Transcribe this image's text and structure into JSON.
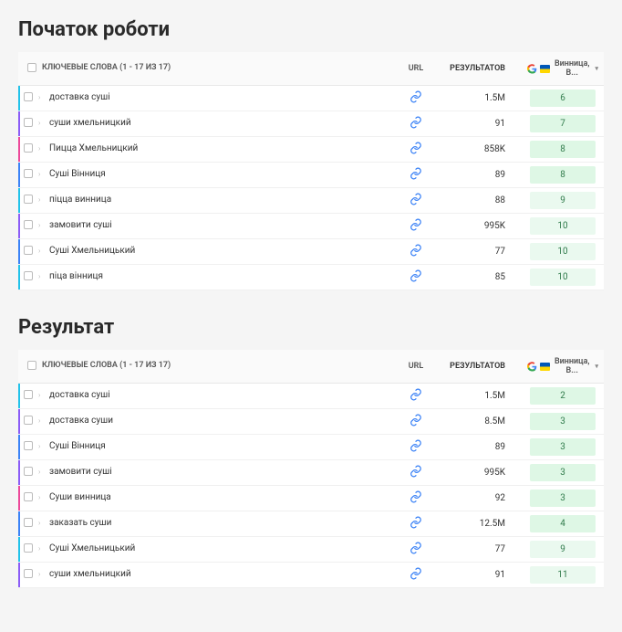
{
  "sections": [
    {
      "title": "Початок роботи",
      "headers": {
        "keywords": "КЛЮЧЕВЫЕ СЛОВА (1 - 17 ИЗ 17)",
        "url": "URL",
        "results": "РЕЗУЛЬТАТОВ",
        "region": "Винница, В..."
      },
      "rows": [
        {
          "kw": "доставка суші",
          "results": "1.5M",
          "rank": "6",
          "color": "#22c2e9"
        },
        {
          "kw": "суши хмельницкий",
          "results": "91",
          "rank": "7",
          "color": "#8b5cf6"
        },
        {
          "kw": "Пицца Хмельницкий",
          "results": "858K",
          "rank": "8",
          "color": "#ec4899"
        },
        {
          "kw": "Суші Вінниця",
          "results": "89",
          "rank": "8",
          "color": "#3b82f6"
        },
        {
          "kw": "піцца винница",
          "results": "88",
          "rank": "9",
          "color": "#22c2e9"
        },
        {
          "kw": "замовити суші",
          "results": "995K",
          "rank": "10",
          "color": "#8b5cf6"
        },
        {
          "kw": "Суші Хмельницький",
          "results": "77",
          "rank": "10",
          "color": "#3b82f6"
        },
        {
          "kw": "піца вінниця",
          "results": "85",
          "rank": "10",
          "color": "#22c2e9"
        }
      ]
    },
    {
      "title": "Результат",
      "headers": {
        "keywords": "КЛЮЧЕВЫЕ СЛОВА (1 - 17 ИЗ 17)",
        "url": "URL",
        "results": "РЕЗУЛЬТАТОВ",
        "region": "Винница, В..."
      },
      "rows": [
        {
          "kw": "доставка суші",
          "results": "1.5M",
          "rank": "2",
          "color": "#22c2e9"
        },
        {
          "kw": "доставка суши",
          "results": "8.5M",
          "rank": "3",
          "color": "#8b5cf6"
        },
        {
          "kw": "Суші Вінниця",
          "results": "89",
          "rank": "3",
          "color": "#3b82f6"
        },
        {
          "kw": "замовити суші",
          "results": "995K",
          "rank": "3",
          "color": "#8b5cf6"
        },
        {
          "kw": "Суши винница",
          "results": "92",
          "rank": "3",
          "color": "#ec4899"
        },
        {
          "kw": "заказать суши",
          "results": "12.5M",
          "rank": "4",
          "color": "#3b82f6"
        },
        {
          "kw": "Суші Хмельницький",
          "results": "77",
          "rank": "9",
          "color": "#22c2e9"
        },
        {
          "kw": "суши хмельницкий",
          "results": "91",
          "rank": "11",
          "color": "#8b5cf6"
        }
      ]
    }
  ]
}
